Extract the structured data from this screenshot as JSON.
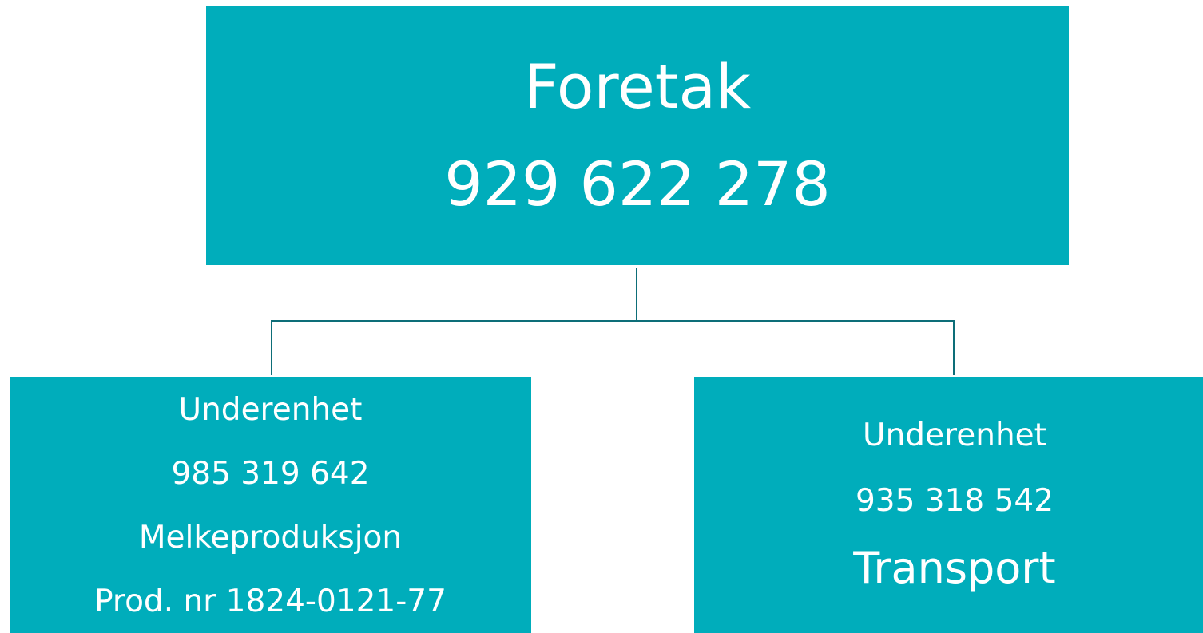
{
  "diagram": {
    "parent": {
      "title": "Foretak",
      "number": "929 622 278"
    },
    "children": [
      {
        "title": "Underenhet",
        "number": "985 319 642",
        "description": "Melkeproduksjon",
        "extra": "Prod. nr 1824-0121-77"
      },
      {
        "title": "Underenhet",
        "number": "935 318 542",
        "description": "Transport"
      }
    ],
    "colors": {
      "box_fill": "#00adbb",
      "connector": "#0d6e78",
      "text": "#ffffff",
      "background": "#ffffff"
    }
  }
}
